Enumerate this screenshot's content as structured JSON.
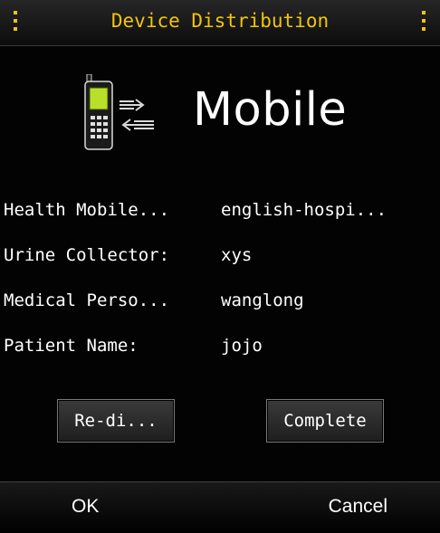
{
  "titlebar": {
    "title": "Device Distribution",
    "left_icon": "vertical-dots-icon",
    "right_icon": "vertical-dots-icon",
    "accent_color": "#f1c40f"
  },
  "header": {
    "icon": "mobile-phone-transfer-icon",
    "app_name": "Mobile"
  },
  "details": [
    {
      "label": "Health Mobile...",
      "value": "english-hospi..."
    },
    {
      "label": "Urine Collector:",
      "value": "xys"
    },
    {
      "label": "Medical Perso...",
      "value": "wanglong"
    },
    {
      "label": "Patient Name:",
      "value": "jojo"
    }
  ],
  "buttons": {
    "redistribute_label": "Re-di...",
    "complete_label": "Complete"
  },
  "softkeys": {
    "left_label": "OK",
    "right_label": "Cancel"
  }
}
